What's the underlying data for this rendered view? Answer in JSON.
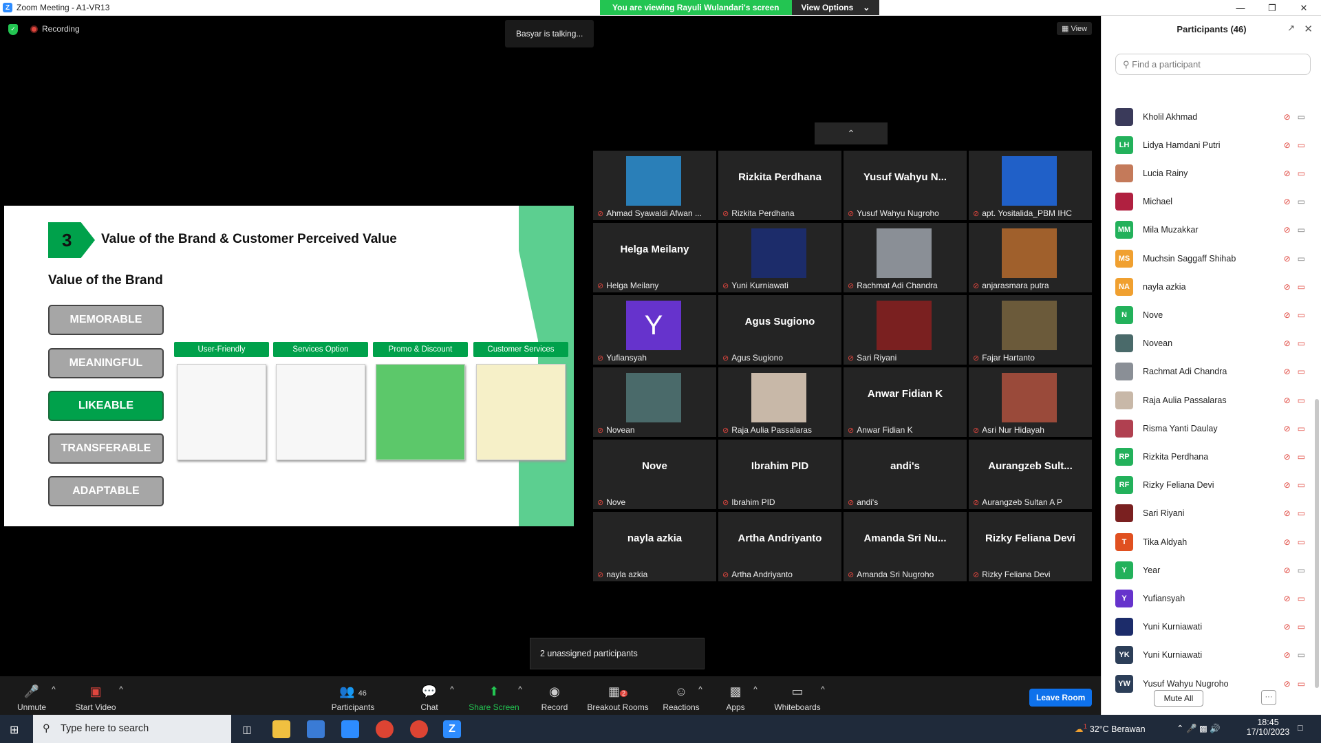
{
  "window": {
    "title": "Zoom Meeting - A1-VR13",
    "logo": "Z"
  },
  "banner": {
    "message": "You are viewing Rayuli Wulandari's screen",
    "view_options": "View Options"
  },
  "recording": "Recording",
  "talking": "Basyar is talking...",
  "view_label": "View",
  "slide": {
    "number": "3",
    "title": "Value of the Brand & Customer Perceived Value",
    "subtitle": "Value of the Brand",
    "values": [
      "MEMORABLE",
      "MEANINGFUL",
      "LIKEABLE",
      "TRANSFERABLE",
      "ADAPTABLE"
    ],
    "cards": [
      "User-Friendly",
      "Services Option",
      "Promo & Discount",
      "Customer Services"
    ]
  },
  "tiles": [
    {
      "big": "",
      "label": "Ahmad Syawaldi Afwan ...",
      "color": "#2a7fb8"
    },
    {
      "big": "Rizkita Perdhana",
      "label": "Rizkita Perdhana"
    },
    {
      "big": "Yusuf Wahyu N...",
      "label": "Yusuf Wahyu Nugroho"
    },
    {
      "big": "",
      "label": "apt. Yositalida_PBM IHC",
      "color": "#2060c8"
    },
    {
      "big": "Helga Meilany",
      "label": "Helga Meilany"
    },
    {
      "big": "",
      "label": "Yuni Kurniawati",
      "color": "#1c2c6a"
    },
    {
      "big": "",
      "label": "Rachmat Adi Chandra",
      "color": "#8a8f96"
    },
    {
      "big": "",
      "label": "anjarasmara putra",
      "color": "#a0602c"
    },
    {
      "big": "",
      "label": "Yufiansyah",
      "color": "#6633cc",
      "letter": "Y"
    },
    {
      "big": "Agus Sugiono",
      "label": "Agus Sugiono"
    },
    {
      "big": "",
      "label": "Sari Riyani",
      "color": "#7a2020"
    },
    {
      "big": "",
      "label": "Fajar Hartanto",
      "color": "#6b5a3a"
    },
    {
      "big": "",
      "label": "Novean",
      "color": "#4a6a6a"
    },
    {
      "big": "",
      "label": "Raja Aulia Passalaras",
      "color": "#c8b8a8"
    },
    {
      "big": "Anwar Fidian K",
      "label": "Anwar Fidian K"
    },
    {
      "big": "",
      "label": "Asri Nur Hidayah",
      "color": "#9a4a3a"
    },
    {
      "big": "Nove",
      "label": "Nove"
    },
    {
      "big": "Ibrahim PID",
      "label": "Ibrahim PID"
    },
    {
      "big": "andi's",
      "label": "andi's"
    },
    {
      "big": "Aurangzeb  Sult...",
      "label": "Aurangzeb Sultan A P"
    },
    {
      "big": "nayla azkia",
      "label": "nayla azkia"
    },
    {
      "big": "Artha Andriyanto",
      "label": "Artha Andriyanto"
    },
    {
      "big": "Amanda Sri Nu...",
      "label": "Amanda Sri Nugroho"
    },
    {
      "big": "Rizky Feliana Devi",
      "label": "Rizky Feliana Devi"
    }
  ],
  "unassigned": "2 unassigned participants",
  "toolbar": {
    "unmute": "Unmute",
    "start_video": "Start Video",
    "participants": "Participants",
    "participants_count": "46",
    "chat": "Chat",
    "share": "Share Screen",
    "record": "Record",
    "breakout": "Breakout Rooms",
    "breakout_badge": "2",
    "reactions": "Reactions",
    "apps": "Apps",
    "whiteboards": "Whiteboards",
    "leave": "Leave Room"
  },
  "panel": {
    "title": "Participants (46)",
    "search_placeholder": "Find a participant",
    "mute_all": "Mute All",
    "more": "···",
    "participants": [
      {
        "initials": "",
        "name": "Kholil Akhmad",
        "color": "#3a3a5a",
        "cam": "on"
      },
      {
        "initials": "LH",
        "name": "Lidya Hamdani Putri",
        "color": "#23b15b",
        "cam": "off"
      },
      {
        "initials": "",
        "name": "Lucia Rainy",
        "color": "#c47a5a",
        "cam": "off"
      },
      {
        "initials": "",
        "name": "Michael",
        "color": "#b02040",
        "cam": "on"
      },
      {
        "initials": "MM",
        "name": "Mila Muzakkar",
        "color": "#23b15b",
        "cam": "on"
      },
      {
        "initials": "MS",
        "name": "Muchsin Saggaff Shihab",
        "color": "#f0a030",
        "cam": "on"
      },
      {
        "initials": "NA",
        "name": "nayla azkia",
        "color": "#f0a030",
        "cam": "off"
      },
      {
        "initials": "N",
        "name": "Nove",
        "color": "#23b15b",
        "cam": "off"
      },
      {
        "initials": "",
        "name": "Novean",
        "color": "#4a6a6a",
        "cam": "off"
      },
      {
        "initials": "",
        "name": "Rachmat Adi Chandra",
        "color": "#8a8f96",
        "cam": "off"
      },
      {
        "initials": "",
        "name": "Raja Aulia Passalaras",
        "color": "#c8b8a8",
        "cam": "off"
      },
      {
        "initials": "",
        "name": "Risma Yanti Daulay",
        "color": "#b04050",
        "cam": "off"
      },
      {
        "initials": "RP",
        "name": "Rizkita Perdhana",
        "color": "#23b15b",
        "cam": "off"
      },
      {
        "initials": "RF",
        "name": "Rizky Feliana Devi",
        "color": "#23b15b",
        "cam": "off"
      },
      {
        "initials": "",
        "name": "Sari Riyani",
        "color": "#7a2020",
        "cam": "off"
      },
      {
        "initials": "T",
        "name": "Tika Aldyah",
        "color": "#e05020",
        "cam": "off"
      },
      {
        "initials": "Y",
        "name": "Year",
        "color": "#23b15b",
        "cam": "on"
      },
      {
        "initials": "Y",
        "name": "Yufiansyah",
        "color": "#6633cc",
        "cam": "off"
      },
      {
        "initials": "",
        "name": "Yuni Kurniawati",
        "color": "#1c2c6a",
        "cam": "off"
      },
      {
        "initials": "YK",
        "name": "Yuni Kurniawati",
        "color": "#2c3e58",
        "cam": "on"
      },
      {
        "initials": "YW",
        "name": "Yusuf Wahyu Nugroho",
        "color": "#2c3e58",
        "cam": "off"
      }
    ]
  },
  "taskbar": {
    "search_placeholder": "Type here to search",
    "weather": "32°C  Berawan",
    "time": "18:45",
    "date": "17/10/2023",
    "notif": "1"
  }
}
